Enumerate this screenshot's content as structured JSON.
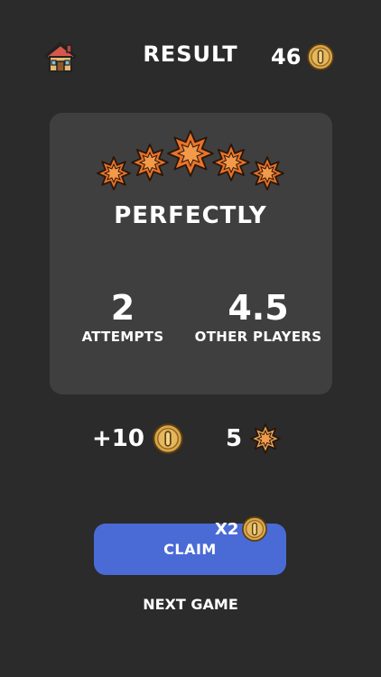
{
  "header": {
    "home_icon": "house-icon",
    "title": "RESULT",
    "coins": "46",
    "coin_icon": "coin-icon"
  },
  "result": {
    "stars_earned": 5,
    "stars_total": 5,
    "rating": "PERFECTLY",
    "attempts_value": "2",
    "attempts_label": "ATTEMPTS",
    "others_value": "4.5",
    "others_label": "OTHER PLAYERS"
  },
  "rewards": {
    "coins": "+10",
    "stars": "5"
  },
  "claim": {
    "label": "CLAIM",
    "multiplier": "X2"
  },
  "next_game": "NEXT GAME",
  "colors": {
    "background": "#2b2b2b",
    "card": "#3f3f3f",
    "button": "#4a6bd6",
    "star": "#e8732a",
    "coin": "#d9a548"
  }
}
